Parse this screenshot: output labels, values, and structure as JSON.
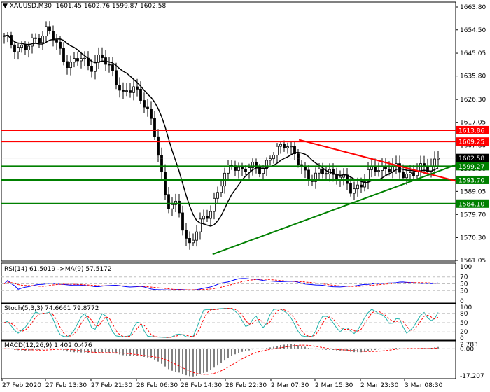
{
  "header": {
    "symbol": "XAUUSD,M30",
    "ohlc": "1601.45 1602.76 1599.87 1602.58"
  },
  "chart_data": {
    "type": "line",
    "title": "XAUUSD,M30",
    "ylim": [
      1561.05,
      1663.8
    ],
    "y_ticks": [
      "1663.80",
      "1654.50",
      "1645.05",
      "1635.80",
      "1626.30",
      "1617.05",
      "1607.80",
      "1598.30",
      "1589.05",
      "1579.70",
      "1570.30",
      "1561.05"
    ],
    "x_ticks": [
      "27 Feb 2020",
      "27 Feb 13:30",
      "27 Feb 21:30",
      "28 Feb 06:30",
      "28 Feb 14:30",
      "28 Feb 22:30",
      "2 Mar 07:30",
      "2 Mar 15:30",
      "2 Mar 23:30",
      "3 Mar 08:30"
    ],
    "close_path": [
      1651,
      1648,
      1646.7,
      1651,
      1655,
      1647,
      1640,
      1643,
      1640,
      1643,
      1638,
      1627,
      1632,
      1624,
      1610,
      1584,
      1582,
      1567,
      1575,
      1582,
      1592,
      1601,
      1597,
      1599,
      1599,
      1605,
      1610,
      1601,
      1595,
      1596,
      1597,
      1595,
      1589,
      1593,
      1598,
      1599,
      1598,
      1596,
      1597,
      1599,
      1602.6
    ],
    "levels": [
      {
        "price": 1613.86,
        "label": "1613.86",
        "color": "#ff0000"
      },
      {
        "price": 1609.25,
        "label": "1609.25",
        "color": "#ff0000"
      },
      {
        "price": 1602.58,
        "label": "1602.58",
        "color": "#000000"
      },
      {
        "price": 1599.27,
        "label": "1599.27",
        "color": "#008000"
      },
      {
        "price": 1593.7,
        "label": "1593.70",
        "color": "#008000"
      },
      {
        "price": 1584.1,
        "label": "1584.10",
        "color": "#008000"
      }
    ],
    "trendlines": [
      {
        "name": "resistance",
        "color": "#ff0000",
        "from": [
          0.655,
          1610
        ],
        "to": [
          1.0,
          1593.3
        ]
      },
      {
        "name": "support",
        "color": "#008000",
        "from": [
          0.465,
          1563.5
        ],
        "to": [
          1.0,
          1599.8
        ]
      }
    ],
    "indicators": {
      "rsi": {
        "label": "RSI(14) 61.5019  ->MA(9) 57.5172",
        "ticks": [
          "100",
          "70",
          "50",
          "30",
          "0"
        ]
      },
      "stoch": {
        "label": "Stoch(5,3,3) 74.6661 79.8772",
        "ticks": [
          "100",
          "80",
          "50",
          "20",
          "0"
        ]
      },
      "macd": {
        "label": "MACD(12,26,9) 1.402 0.476",
        "ticks": [
          "2.783",
          "0.00",
          "-17.207"
        ]
      }
    }
  }
}
